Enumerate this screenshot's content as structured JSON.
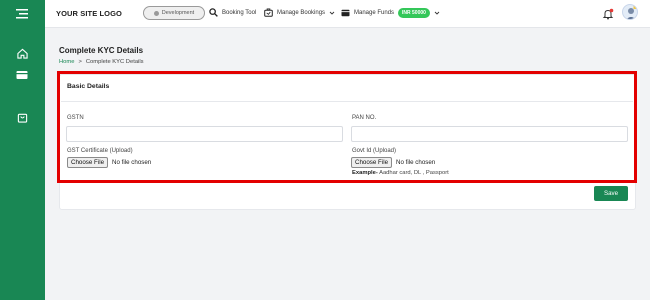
{
  "topbar": {
    "logo": "YOUR SITE LOGO",
    "environment": "Development",
    "nav": [
      {
        "label": "Booking Tool",
        "icon": "search-icon"
      },
      {
        "label": "Manage Bookings",
        "icon": "briefcase-icon"
      },
      {
        "label": "Manage Funds",
        "icon": "wallet-icon",
        "badge": "INR 50000"
      }
    ]
  },
  "page": {
    "title": "Complete KYC Details",
    "breadcrumb": {
      "home": "Home",
      "separator": ">",
      "current": "Complete KYC Details"
    }
  },
  "form": {
    "section_title": "Basic Details",
    "gstn_label": "GSTN",
    "gstn_value": "",
    "pan_label": "PAN NO.",
    "pan_value": "",
    "gst_cert_label": "GST Certificate (Upload)",
    "govt_id_label": "Govt Id (Upload)",
    "choose_file": "Choose File",
    "no_file": "No file chosen",
    "hint_prefix": "Example-",
    "hint_text": " Aadhar card, DL , Passport",
    "save": "Save"
  },
  "colors": {
    "brand": "#198754",
    "highlight": "#e30000",
    "badge": "#34c759"
  }
}
